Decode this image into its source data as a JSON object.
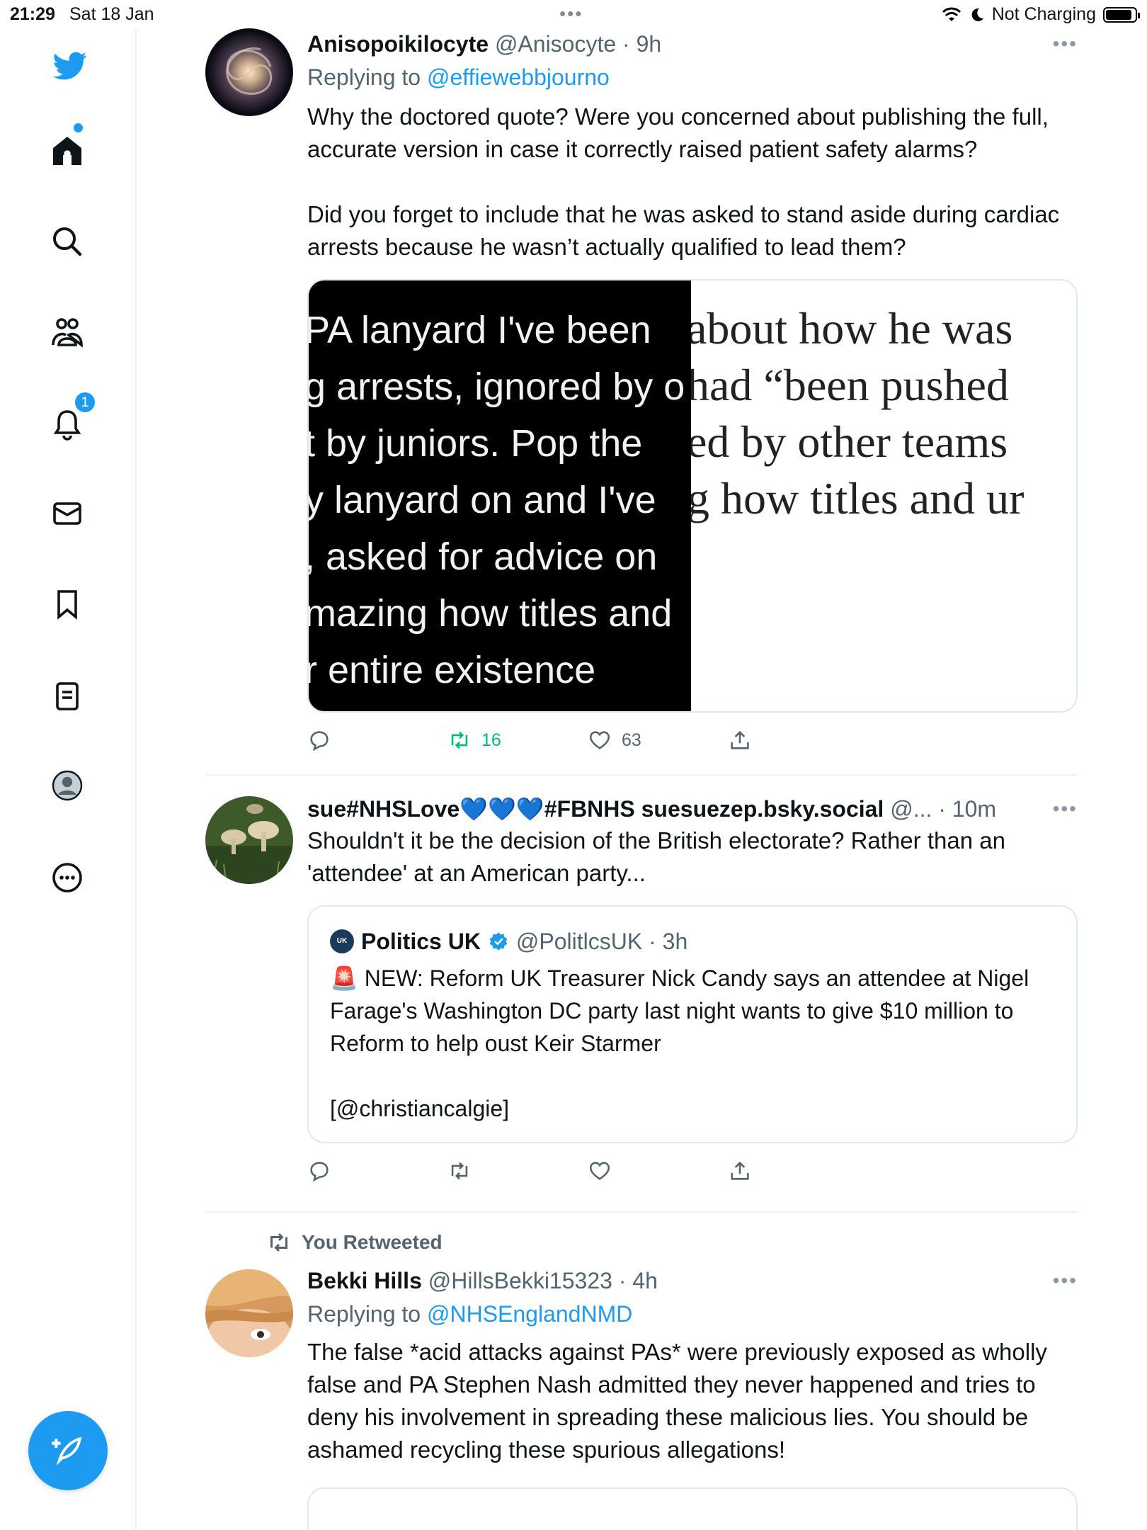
{
  "status_bar": {
    "time": "21:29",
    "date": "Sat 18 Jan",
    "battery_text": "Not Charging"
  },
  "sidebar": {
    "notifications_badge": "1"
  },
  "tweets": [
    {
      "name": "Anisopoikilocyte",
      "handle": "@Anisocyte",
      "time": "9h",
      "replying_prefix": "Replying to ",
      "replying_to": "@effiewebbjourno",
      "text": "Why the doctored quote? Were you concerned about publishing the full, accurate version in case it correctly raised patient safety alarms?\n\nDid you forget to include that he was asked to stand aside during cardiac arrests because he wasn’t actually qualified to lead them?",
      "media_left_lines": [
        "PA lanyard I've been ",
        "g arrests, ignored by o",
        "t by juniors. Pop the",
        "y lanyard on and I've ",
        ", asked for advice on ",
        "mazing how titles and",
        "r entire existence"
      ],
      "media_right_lines": [
        "about how he was",
        "had “been pushed",
        "ed by other teams",
        "g how titles and ur"
      ],
      "retweets": "16",
      "likes": "63"
    },
    {
      "name": "sue#NHSLove💙💙💙#FBNHS suesuezep.bsky.social",
      "handle": "@...",
      "time": "10m",
      "text": "Shouldn't it be the decision of the British electorate? Rather than an 'attendee' at an American party...",
      "quote": {
        "logo_text": "UK",
        "name": "Politics UK",
        "handle": "@PolitlcsUK",
        "time": "3h",
        "text": "🚨 NEW: Reform UK Treasurer Nick Candy says an attendee at Nigel Farage's Washington DC party last night wants to give $10 million to Reform to help oust Keir Starmer\n\n[@christiancalgie]"
      }
    },
    {
      "retweet_label": "You Retweeted",
      "name": "Bekki Hills",
      "handle": "@HillsBekki15323",
      "time": "4h",
      "replying_prefix": "Replying to ",
      "replying_to": "@NHSEnglandNMD",
      "text": "The false *acid attacks against PAs* were previously exposed as wholly false and PA Stephen Nash admitted they never happened and tries to deny his involvement in spreading these malicious lies. You should be ashamed recycling these spurious allegations!"
    }
  ],
  "colors": {
    "accent": "#1d9bf0",
    "retweet_green": "#00ba7c",
    "muted": "#536471"
  }
}
